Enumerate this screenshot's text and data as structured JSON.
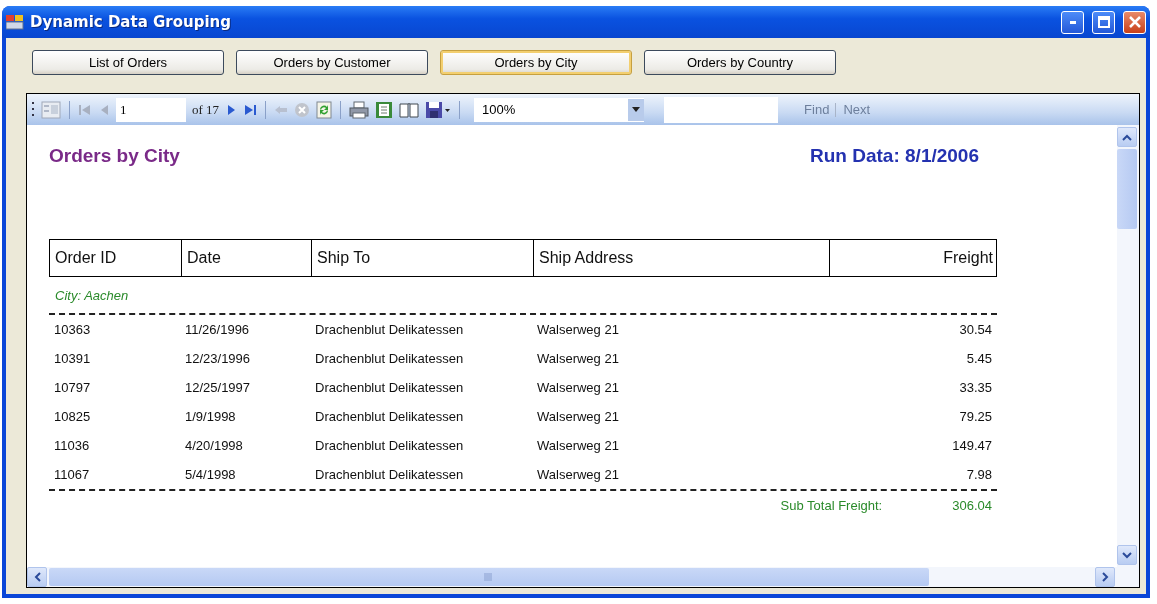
{
  "window": {
    "title": "Dynamic Data Grouping"
  },
  "view_buttons": [
    {
      "label": "List of Orders",
      "selected": false
    },
    {
      "label": "Orders by Customer",
      "selected": false
    },
    {
      "label": "Orders by City",
      "selected": true
    },
    {
      "label": "Orders by Country",
      "selected": false
    }
  ],
  "toolbar": {
    "page": "1",
    "page_count": "of 17",
    "zoom": "100%",
    "find": {
      "label": "Find",
      "disabled": true
    },
    "next": {
      "label": "Next",
      "disabled": true
    }
  },
  "report": {
    "title": "Orders by City",
    "run_date": "Run Data: 8/1/2006",
    "columns": [
      "Order ID",
      "Date",
      "Ship To",
      "Ship Address",
      "Freight"
    ],
    "groups": [
      {
        "label": "City: Aachen",
        "subtotal_label": "Sub Total Freight:",
        "subtotal": "306.04",
        "rows": [
          [
            "10363",
            "11/26/1996",
            "Drachenblut Delikatessen",
            "Walserweg 21",
            "30.54"
          ],
          [
            "10391",
            "12/23/1996",
            "Drachenblut Delikatessen",
            "Walserweg 21",
            "5.45"
          ],
          [
            "10797",
            "12/25/1997",
            "Drachenblut Delikatessen",
            "Walserweg 21",
            "33.35"
          ],
          [
            "10825",
            "1/9/1998",
            "Drachenblut Delikatessen",
            "Walserweg 21",
            "79.25"
          ],
          [
            "11036",
            "4/20/1998",
            "Drachenblut Delikatessen",
            "Walserweg 21",
            "149.47"
          ],
          [
            "11067",
            "5/4/1998",
            "Drachenblut Delikatessen",
            "Walserweg 21",
            "7.98"
          ]
        ]
      }
    ]
  }
}
